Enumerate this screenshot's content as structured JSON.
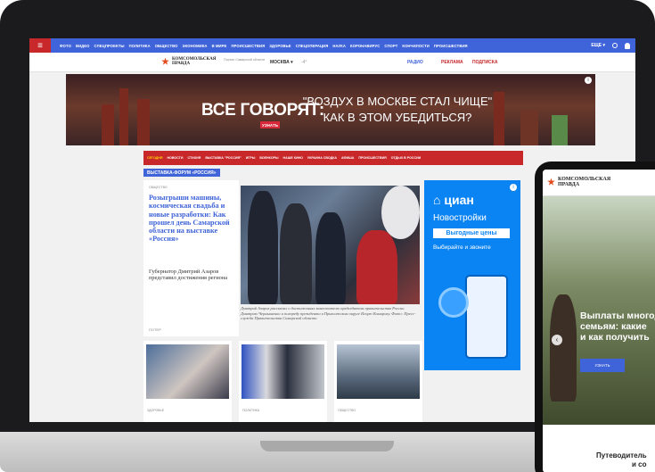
{
  "topnav": {
    "items": [
      "ФОТО",
      "ВИДЕО",
      "СПЕЦПРОЕКТЫ",
      "ПОЛИТИКА",
      "ОБЩЕСТВО",
      "ЭКОНОМИКА",
      "В МИРЕ",
      "ПРОИСШЕСТВИЯ",
      "ЗДОРОВЬЕ",
      "СПЕЦОПЕРАЦИЯ",
      "НАУКА",
      "КОРОНАВИРУС",
      "СПОРТ",
      "КОНЧИЛОСТИ",
      "ПРОИСШЕСТВИЯ"
    ],
    "more": "ЕЩЕ ▾"
  },
  "brand": {
    "logo_text": "КОМСОМОЛЬСКАЯ ПРАВДА",
    "partner_text": "Портал Самарской области",
    "region": "МОСКВА ▾",
    "weather": "-4°",
    "radio": "РАДИО",
    "ads": "РЕКЛАМА",
    "subscribe": "ПОДПИСКА"
  },
  "banner": {
    "headline": "ВСЕ ГОВОРЯТ:",
    "button": "УЗНАТЬ",
    "quote_line1": "\"ВОЗДУХ В МОСКВЕ СТАЛ ЧИЩЕ\"",
    "quote_line2": "КАК В ЭТОМ УБЕДИТЬСЯ?",
    "info": "i"
  },
  "secnav": {
    "items": [
      "СЕГОДНЯ",
      "НОВОСТИ",
      "СТИХИЯ",
      "ВЫСТАВКА \"РОССИЯ\"",
      "ИГРЫ",
      "ВОЕНКОРЫ",
      "НАШЕ КИНО",
      "УКРАИНА СВОДКА",
      "АФИША",
      "ПРОИСШЕСТВИЯ",
      "ОТДЫХ В РОССИИ"
    ]
  },
  "tag": "ВЫСТАВКА-ФОРУМ «РОССИЯ»",
  "main_story": {
    "rubric": "ОБЩЕСТВО",
    "headline": "Розыгрыши машины, космическая свадьба и новые разработки: Как прошел день Самарской области на выставке «Россия»",
    "lead": "Губернатор Дмитрий Азаров представил достижения региона",
    "author": "ПОТЕР",
    "caption": "Дмитрий Азаров рассказал о достижениях заместителю председателя правительства России Дмитрию Чернышенко и полпреду президента в Приволжском округе Игорю Комарову. Фото: Пресс-служба Правительства Самарской области"
  },
  "side_ad": {
    "brand": "циан",
    "title": "Новостройки",
    "price_label": "Выгодные цены",
    "call": "Выбирайте и звоните"
  },
  "bottom_cards": [
    {
      "rubric": "ЗДОРОВЬЕ"
    },
    {
      "rubric": "ПОЛИТИКА"
    },
    {
      "rubric": "ОБЩЕСТВО"
    }
  ],
  "phone": {
    "logo_text": "КОМСОМОЛЬСКАЯ ПРАВДА",
    "hero_title_line1": "Выплаты многод",
    "hero_title_line2": "семьям: какие",
    "hero_title_line3": "и как получить",
    "hero_button": "УЗНАТЬ",
    "guide_line1": "Путеводитель",
    "guide_line2": "и со"
  },
  "colors": {
    "brand_blue": "#3f63d8",
    "brand_red": "#c8282a",
    "cian_blue": "#0b84f3"
  }
}
